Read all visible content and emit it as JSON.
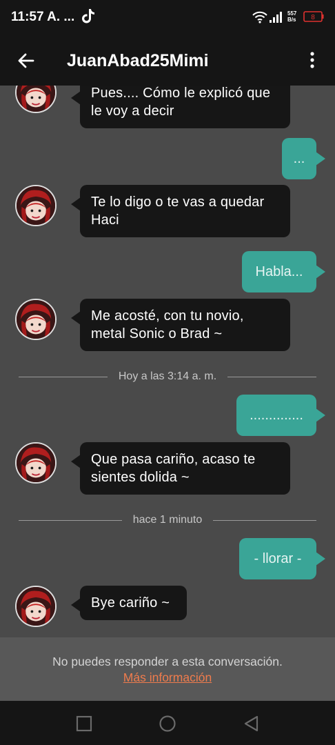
{
  "status": {
    "time": "11:57 A. ...",
    "speed_value": "557",
    "speed_unit": "B/s",
    "battery": "8"
  },
  "header": {
    "title": "JuanAbad25Mimi"
  },
  "messages": [
    {
      "direction": "in",
      "lines": [
        "Pues.... Cómo le explicó que",
        "le voy a decir"
      ]
    },
    {
      "direction": "out",
      "text": "..."
    },
    {
      "direction": "in",
      "lines": [
        "Te lo digo o te vas a quedar",
        "Haci"
      ]
    },
    {
      "direction": "out",
      "text": "Habla..."
    },
    {
      "direction": "in",
      "lines": [
        "Me acosté, con tu novio,",
        "metal Sonic o Brad ~"
      ]
    },
    {
      "direction": "out",
      "text": ".............."
    },
    {
      "direction": "in",
      "lines": [
        "Que pasa cariño, acaso te",
        "sientes dolida ~"
      ]
    },
    {
      "direction": "out",
      "text": "- llorar -"
    },
    {
      "direction": "in",
      "lines": [
        "Bye cariño ~"
      ]
    }
  ],
  "dividers": [
    "Hoy a las 3:14 a. m.",
    "hace 1 minuto"
  ],
  "footer": {
    "notice": "No puedes responder a esta conversación.",
    "link": "Más información"
  },
  "colors": {
    "incoming_bubble": "#161616",
    "outgoing_bubble": "#3aa597",
    "link": "#f07c4d",
    "background": "#4a4a4a"
  }
}
